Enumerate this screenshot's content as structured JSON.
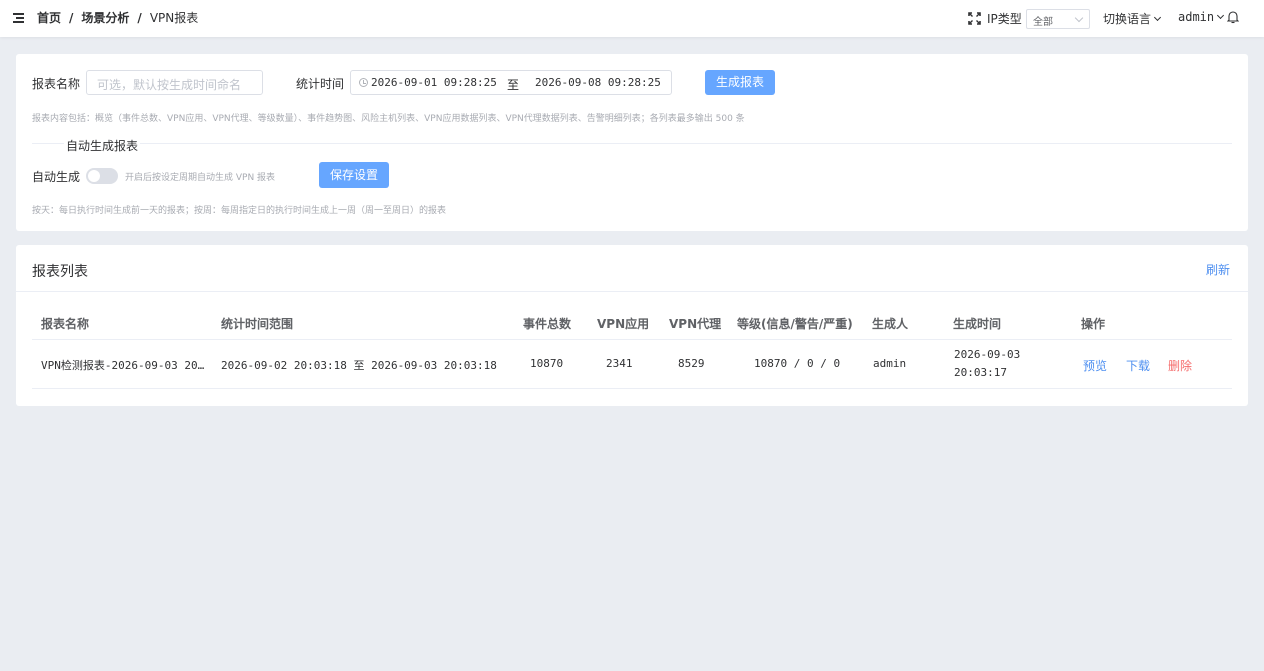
{
  "header": {
    "breadcrumb": [
      "首页",
      "场景分析",
      "VPN报表"
    ],
    "breadcrumb_sep": "/",
    "ip_type_label": "IP类型",
    "ip_type_value": "全部",
    "language": "切换语言",
    "user": "admin",
    "icons": [
      "menu-fold-icon",
      "fullscreen-icon",
      "chevron-down-icon",
      "bell-icon"
    ]
  },
  "form": {
    "report_name_label": "报表名称",
    "report_name_placeholder": "可选，默认按生成时间命名",
    "stat_time_label": "统计时间",
    "date_start": "2026-09-01 09:28:25",
    "date_separator": "至",
    "date_end": "2026-09-08 09:28:25",
    "generate_button": "生成报表",
    "content_hint": "报表内容包括：概览（事件总数、VPN应用、VPN代理、等级数量）、事件趋势图、风险主机列表、VPN应用数据列表、VPN代理数据列表、告警明细列表；各列表最多输出 500 条",
    "auto_section_title": "自动生成报表",
    "auto_label": "自动生成",
    "auto_enabled": false,
    "auto_hint": "开启后按设定周期自动生成 VPN 报表",
    "save_button": "保存设置",
    "schedule_hint": "按天：每日执行时间生成前一天的报表；按周：每周指定日的执行时间生成上一周（周一至周日）的报表"
  },
  "list": {
    "title": "报表列表",
    "refresh": "刷新",
    "columns": [
      "报表名称",
      "统计时间范围",
      "事件总数",
      "VPN应用",
      "VPN代理",
      "等级(信息/警告/严重)",
      "生成人",
      "生成时间",
      "操作"
    ],
    "rows": [
      {
        "name": "VPN检测报表-2026-09-03 20…",
        "range": "2026-09-02 20:03:18 至 2026-09-03 20:03:18",
        "total": "10870",
        "vpn_app": "2341",
        "vpn_proxy": "8529",
        "levels": "10870 / 0 / 0",
        "creator": "admin",
        "created_date": "2026-09-03",
        "created_time": "20:03:17",
        "actions": [
          "预览",
          "下载",
          "删除"
        ]
      }
    ]
  },
  "colors": {
    "primary": "#66a6ff",
    "link": "#4e8ff0",
    "danger": "#f56c6c",
    "background": "#eaedf2"
  }
}
